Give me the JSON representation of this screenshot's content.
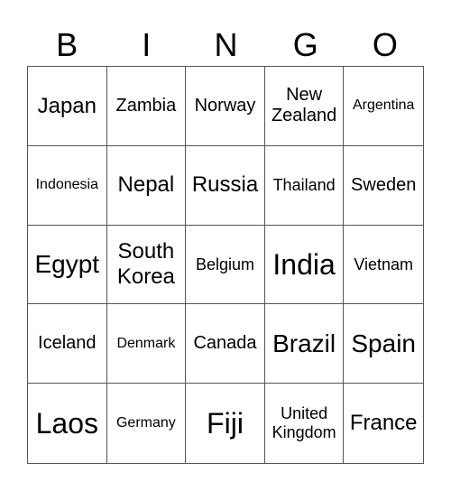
{
  "header": [
    "B",
    "I",
    "N",
    "G",
    "O"
  ],
  "cells": [
    "Japan",
    "Zambia",
    "Norway",
    "New Zealand",
    "Argentina",
    "Indonesia",
    "Nepal",
    "Russia",
    "Thailand",
    "Sweden",
    "Egypt",
    "South Korea",
    "Belgium",
    "India",
    "Vietnam",
    "Iceland",
    "Denmark",
    "Canada",
    "Brazil",
    "Spain",
    "Laos",
    "Germany",
    "Fiji",
    "United Kingdom",
    "France"
  ]
}
